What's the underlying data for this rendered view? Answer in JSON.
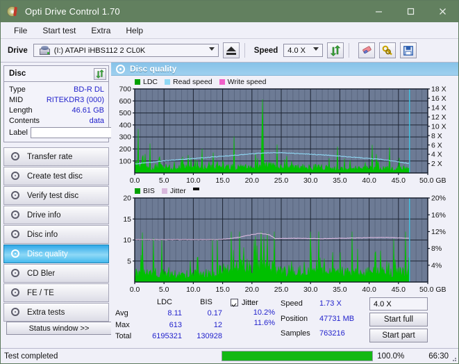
{
  "window": {
    "title": "Opti Drive Control 1.70",
    "icon": "disc-icon",
    "minimize": "–",
    "maximize": "□",
    "close": "✕"
  },
  "menu": {
    "items": [
      "File",
      "Start test",
      "Extra",
      "Help"
    ]
  },
  "toolbar": {
    "drive_label": "Drive",
    "drive_value": "(I:)  ATAPI iHBS112  2 CL0K",
    "eject_title": "Eject",
    "speed_label": "Speed",
    "speed_value": "4.0 X",
    "refresh_title": "Refresh",
    "erase_title": "Erase",
    "tools_title": "Tools",
    "save_title": "Save"
  },
  "disc": {
    "group_title": "Disc",
    "refresh_title": "Refresh disc info",
    "rows": [
      {
        "key": "Type",
        "value": "BD-R DL"
      },
      {
        "key": "MID",
        "value": "RITEKDR3 (000)"
      },
      {
        "key": "Length",
        "value": "46.61 GB"
      },
      {
        "key": "Contents",
        "value": "data"
      }
    ],
    "label_key": "Label",
    "label_value": "",
    "label_placeholder": ""
  },
  "nav": {
    "items": [
      {
        "label": "Transfer rate",
        "active": false
      },
      {
        "label": "Create test disc",
        "active": false
      },
      {
        "label": "Verify test disc",
        "active": false
      },
      {
        "label": "Drive info",
        "active": false
      },
      {
        "label": "Disc info",
        "active": false
      },
      {
        "label": "Disc quality",
        "active": true
      },
      {
        "label": "CD Bler",
        "active": false
      },
      {
        "label": "FE / TE",
        "active": false
      },
      {
        "label": "Extra tests",
        "active": false
      }
    ],
    "status_window": "Status window >>"
  },
  "panel": {
    "title": "Disc quality",
    "icon": "disc-quality-icon"
  },
  "chart_data": [
    {
      "type": "area",
      "title": "LDC / Read speed",
      "xlabel": "GB",
      "ylabel": "LDC",
      "y2label": "X",
      "xlim": [
        0,
        50
      ],
      "ylim": [
        0,
        700
      ],
      "y2lim": [
        0,
        18
      ],
      "grid": true,
      "legend": [
        "LDC",
        "Read speed",
        "Write speed"
      ],
      "legend_colors": [
        "#00a000",
        "#8fd8f4",
        "#f060c8"
      ],
      "legend_position": "top-left",
      "xticks": [
        "0.0",
        "5.0",
        "10.0",
        "15.0",
        "20.0",
        "25.0",
        "30.0",
        "35.0",
        "40.0",
        "45.0",
        "50.0 GB"
      ],
      "yticks": [
        100,
        200,
        300,
        400,
        500,
        600,
        700
      ],
      "y2ticks": [
        "2 X",
        "4 X",
        "6 X",
        "8 X",
        "10 X",
        "12 X",
        "14 X",
        "16 X",
        "18 X"
      ],
      "series": [
        {
          "name": "LDC",
          "color": "#00c000",
          "kind": "spikes",
          "note": "dense green error spikes from 0 to 46.9 GB; baseline ~40-90, frequent spikes 150-350, max spike 613 near 21.8 GB",
          "data_end_gb": 46.9,
          "baseline": 60,
          "max": 613
        },
        {
          "name": "Read speed",
          "color": "#8fd8f4",
          "kind": "line",
          "note": "rises from ~2.0X at 0 GB to ~4.4X around 22 GB then declines to ~2.0X at 46.9 GB",
          "points_gb_x": [
            [
              0,
              1.9
            ],
            [
              2,
              2.2
            ],
            [
              5,
              2.6
            ],
            [
              8,
              2.9
            ],
            [
              11,
              3.2
            ],
            [
              14,
              3.5
            ],
            [
              17,
              3.8
            ],
            [
              19,
              4.0
            ],
            [
              21,
              4.2
            ],
            [
              23,
              4.3
            ],
            [
              25,
              4.35
            ],
            [
              27,
              4.2
            ],
            [
              30,
              4.0
            ],
            [
              33,
              3.8
            ],
            [
              36,
              3.5
            ],
            [
              39,
              3.2
            ],
            [
              42,
              2.9
            ],
            [
              45,
              2.4
            ],
            [
              46.9,
              2.0
            ]
          ]
        },
        {
          "name": "Write speed",
          "color": "#f060c8",
          "kind": "line",
          "note": "not plotted"
        },
        {
          "name": "cursor",
          "color": "#40d0f0",
          "kind": "vline",
          "x_gb": 46.9
        }
      ]
    },
    {
      "type": "area",
      "title": "BIS / Jitter",
      "xlabel": "GB",
      "ylabel": "BIS",
      "y2label": "%",
      "xlim": [
        0,
        50
      ],
      "ylim": [
        0,
        20
      ],
      "y2lim": [
        0,
        20
      ],
      "grid": true,
      "legend": [
        "BIS",
        "Jitter"
      ],
      "legend_colors": [
        "#00a000",
        "#d9b8dd"
      ],
      "legend_position": "top-left",
      "xticks": [
        "0.0",
        "5.0",
        "10.0",
        "15.0",
        "20.0",
        "25.0",
        "30.0",
        "35.0",
        "40.0",
        "45.0",
        "50.0 GB"
      ],
      "yticks": [
        5,
        10,
        15,
        20
      ],
      "y2ticks": [
        "4%",
        "8%",
        "12%",
        "16%",
        "20%"
      ],
      "series": [
        {
          "name": "BIS",
          "color": "#00c000",
          "kind": "spikes",
          "note": "dense green spikes baseline ~2-4, spikes up to 9-12 mostly after 15 GB; max 12",
          "data_end_gb": 46.9,
          "baseline": 3,
          "max": 12
        },
        {
          "name": "Jitter",
          "color": "#d9b8dd",
          "kind": "line",
          "note": "approx 10.1% flat 0-15 GB, rising to 11.6% at 21.5 GB, dips back to ~10.2% and flat to 46.9 GB",
          "points_gb_pct": [
            [
              0,
              10.1
            ],
            [
              5,
              10.1
            ],
            [
              10,
              10.1
            ],
            [
              14,
              10.1
            ],
            [
              16,
              10.3
            ],
            [
              18,
              10.7
            ],
            [
              20,
              11.3
            ],
            [
              21.5,
              11.6
            ],
            [
              23,
              11.2
            ],
            [
              24,
              10.3
            ],
            [
              27,
              10.4
            ],
            [
              32,
              10.3
            ],
            [
              38,
              10.5
            ],
            [
              43,
              10.6
            ],
            [
              46.9,
              10.4
            ]
          ]
        },
        {
          "name": "cursor",
          "color": "#40d0f0",
          "kind": "vline",
          "x_gb": 46.9
        }
      ]
    }
  ],
  "stats": {
    "col_headers": [
      "",
      "LDC",
      "BIS"
    ],
    "rows": [
      {
        "key": "Avg",
        "ldc": "8.11",
        "bis": "0.17"
      },
      {
        "key": "Max",
        "ldc": "613",
        "bis": "12"
      },
      {
        "key": "Total",
        "ldc": "6195321",
        "bis": "130928"
      }
    ],
    "jitter_label": "Jitter",
    "jitter_checked": true,
    "jitter_values": [
      "10.2%",
      "11.6%"
    ],
    "speed_key": "Speed",
    "speed_value": "1.73 X",
    "position_key": "Position",
    "position_value": "47731 MB",
    "samples_key": "Samples",
    "samples_value": "763216",
    "speed_select": "4.0 X",
    "start_full": "Start full",
    "start_part": "Start part"
  },
  "statusbar": {
    "message": "Test completed",
    "progress_pct": 100.0,
    "progress_text": "100.0%",
    "elapsed": "66:30"
  },
  "colors": {
    "titlebar": "#62805f",
    "accent": "#2222cc",
    "panel_header": "#8fc8ec",
    "chart_bg": "#6d7b95",
    "ldc_green": "#00c000",
    "read_speed": "#8fd8f4",
    "jitter_pink": "#d9b8dd",
    "progress_green": "#14b814"
  }
}
